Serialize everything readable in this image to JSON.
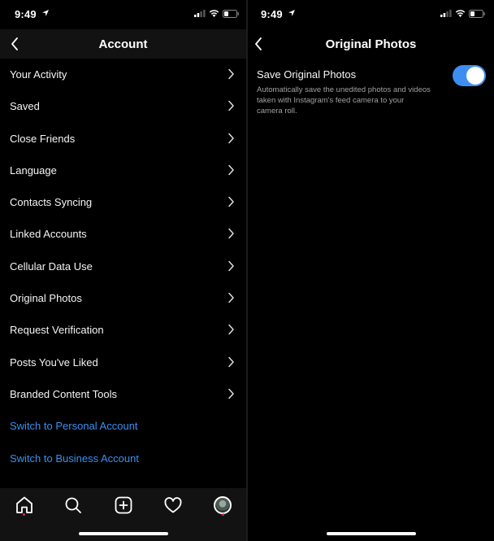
{
  "status_bar": {
    "time": "9:49"
  },
  "account_screen": {
    "title": "Account",
    "menu_items": [
      {
        "label": "Your Activity"
      },
      {
        "label": "Saved"
      },
      {
        "label": "Close Friends"
      },
      {
        "label": "Language"
      },
      {
        "label": "Contacts Syncing"
      },
      {
        "label": "Linked Accounts"
      },
      {
        "label": "Cellular Data Use"
      },
      {
        "label": "Original Photos"
      },
      {
        "label": "Request Verification"
      },
      {
        "label": "Posts You've Liked"
      },
      {
        "label": "Branded Content Tools"
      }
    ],
    "links": [
      {
        "label": "Switch to Personal Account"
      },
      {
        "label": "Switch to Business Account"
      }
    ]
  },
  "original_photos_screen": {
    "title": "Original Photos",
    "setting_title": "Save Original Photos",
    "setting_description": "Automatically save the unedited photos and videos taken with Instagram's feed camera to your camera roll.",
    "toggle_on": true
  },
  "tab_bar": {
    "tabs": [
      "home-icon",
      "search-icon",
      "new-post-icon",
      "activity-heart-icon",
      "profile-avatar"
    ]
  },
  "colors": {
    "background": "#000000",
    "header": "#121212",
    "link_blue": "#3c8ff0",
    "toggle_blue": "#3c8ff0",
    "notification_dot": "#e0245e"
  }
}
